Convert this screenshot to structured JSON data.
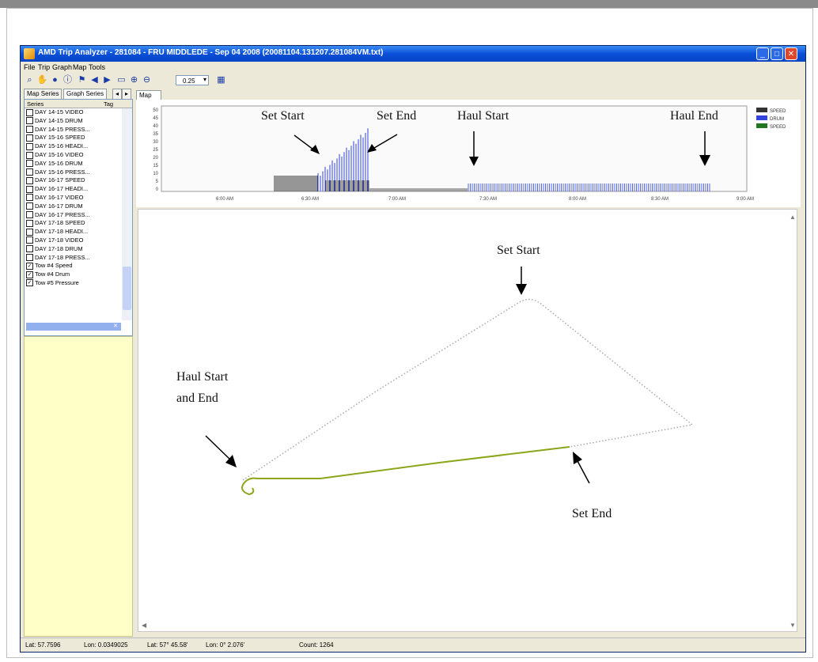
{
  "window": {
    "title": "AMD Trip Analyzer - 281084 - FRU MIDDLEDE - Sep 04 2008 (20081104.131207.281084VM.txt)"
  },
  "window_buttons": {
    "minimize": "_",
    "maximize": "□",
    "close": "✕"
  },
  "menu": [
    "File",
    "Trip",
    "Graph",
    "Map",
    "Tools"
  ],
  "toolbar": {
    "zoom_value": "0.25",
    "icons": [
      "search-icon",
      "hand-icon",
      "globe-icon",
      "info-icon",
      "flag-icon",
      "prev-arrow-icon",
      "next-arrow-icon",
      "select-box-icon",
      "zoom-in-icon",
      "zoom-out-icon",
      "calendar-icon"
    ]
  },
  "left_tabs": [
    "Map Series",
    "Graph Series"
  ],
  "series_header": {
    "col1": "Series",
    "col2": "Tag"
  },
  "series": [
    {
      "label": "DAY 14-15 VIDEO",
      "checked": false
    },
    {
      "label": "DAY 14-15 DRUM",
      "checked": false
    },
    {
      "label": "DAY 14-15 PRESS...",
      "checked": false
    },
    {
      "label": "DAY 15-16 SPEED",
      "checked": false
    },
    {
      "label": "DAY 15-16 HEADI...",
      "checked": false
    },
    {
      "label": "DAY 15-16 VIDEO",
      "checked": false
    },
    {
      "label": "DAY 15-16 DRUM",
      "checked": false
    },
    {
      "label": "DAY 15-16 PRESS...",
      "checked": false
    },
    {
      "label": "DAY 16-17 SPEED",
      "checked": false
    },
    {
      "label": "DAY 16-17 HEADI...",
      "checked": false
    },
    {
      "label": "DAY 16-17 VIDEO",
      "checked": false
    },
    {
      "label": "DAY 16-17 DRUM",
      "checked": false
    },
    {
      "label": "DAY 16-17 PRESS...",
      "checked": false
    },
    {
      "label": "DAY 17-18 SPEED",
      "checked": false
    },
    {
      "label": "DAY 17-18 HEADI...",
      "checked": false
    },
    {
      "label": "DAY 17-18 VIDEO",
      "checked": false
    },
    {
      "label": "DAY 17-18 DRUM",
      "checked": false
    },
    {
      "label": "DAY 17-18 PRESS...",
      "checked": false
    },
    {
      "label": "Tow #4 Speed",
      "checked": true
    },
    {
      "label": "Tow #4 Drum",
      "checked": true
    },
    {
      "label": "Tow #5 Pressure",
      "checked": true
    }
  ],
  "map_tab": "Map",
  "graph": {
    "y_ticks": [
      "50",
      "45",
      "40",
      "35",
      "30",
      "25",
      "20",
      "15",
      "10",
      "5",
      "0"
    ],
    "x_ticks": [
      "6:00 AM",
      "6:30 AM",
      "7:00 AM",
      "7:30 AM",
      "8:00 AM",
      "8:30 AM",
      "9:00 AM"
    ],
    "legend": [
      {
        "label": "SPEED",
        "color": "#333333"
      },
      {
        "label": "DRUM",
        "color": "#3344dd"
      },
      {
        "label": "SPEED",
        "color": "#227722"
      }
    ]
  },
  "annotations": {
    "graph_set_start": "Set Start",
    "graph_set_end": "Set End",
    "graph_haul_start": "Haul Start",
    "graph_haul_end": "Haul End",
    "map_set_start": "Set Start",
    "map_haul_start_line1": "Haul Start",
    "map_haul_start_line2": "and End",
    "map_set_end": "Set End"
  },
  "status": {
    "lat": "Lat: 57.7596",
    "lon": "Lon: 0.0349025",
    "lat_dms": "Lat: 57° 45.58'",
    "lon_dms": "Lon: 0° 2.076'",
    "count": "Count: 1264"
  },
  "colors": {
    "track_green": "#8aa61a",
    "titlebar": "#0a50d8"
  }
}
